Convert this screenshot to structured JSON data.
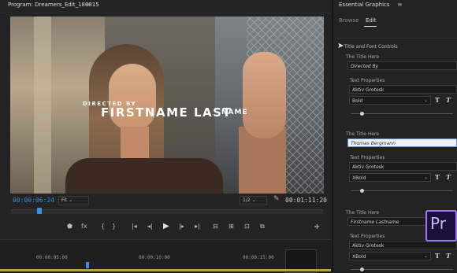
{
  "program": {
    "title": "Program: Dreamers_Edit_180815",
    "menu_icon": "hamburger-icon",
    "overlay": {
      "directed_by": "DIRECTED BY",
      "name": "FIRSTNAME LAST",
      "name_tail": "NAME"
    },
    "timecode_current": "00:00:06:24",
    "fit": "Fit",
    "resolution": "1/2",
    "timecode_duration": "00:01:11:20",
    "timeline_ticks": [
      "00:00:05:00",
      "00:00:10:00",
      "00:00:15:00"
    ],
    "controls": [
      "marker-icon",
      "fx-icon",
      "mark-in-icon",
      "mark-out-icon",
      "go-to-in-icon",
      "step-back-icon",
      "play-icon",
      "step-forward-icon",
      "go-to-out-icon",
      "insert-icon",
      "overwrite-icon",
      "camera-icon",
      "multi-icon"
    ],
    "control_glyphs": [
      "⬟",
      "fx",
      "{",
      "}",
      "|◂",
      "◂|",
      "▶",
      "|▸",
      "▸|",
      "⊟",
      "⊞",
      "⊡",
      "⧉"
    ],
    "add_button": "+"
  },
  "essential_graphics": {
    "title": "Essential Graphics",
    "menu_icon": "hamburger-icon",
    "tabs": [
      {
        "label": "Browse"
      },
      {
        "label": "Edit"
      }
    ],
    "section": "Title and Font Controls",
    "groups": [
      {
        "label": "The Title Here",
        "value": "Directed By",
        "props_label": "Text Properties",
        "font": "Aktiv Grotesk",
        "weight": "Bold"
      },
      {
        "label": "The Title Here",
        "value": "Thomas Bergmann",
        "props_label": "Text Properties",
        "font": "Aktiv Grotesk",
        "weight": "XBold"
      },
      {
        "label": "The Title Here",
        "value": "Firstname Lastname",
        "props_label": "Text Properties",
        "font": "Aktiv Grotesk",
        "weight": "XBold"
      }
    ],
    "badge": "Pr"
  },
  "colors": {
    "accent": "#3d8fe0",
    "panel": "#232323",
    "badge": "#9b7bf0"
  }
}
